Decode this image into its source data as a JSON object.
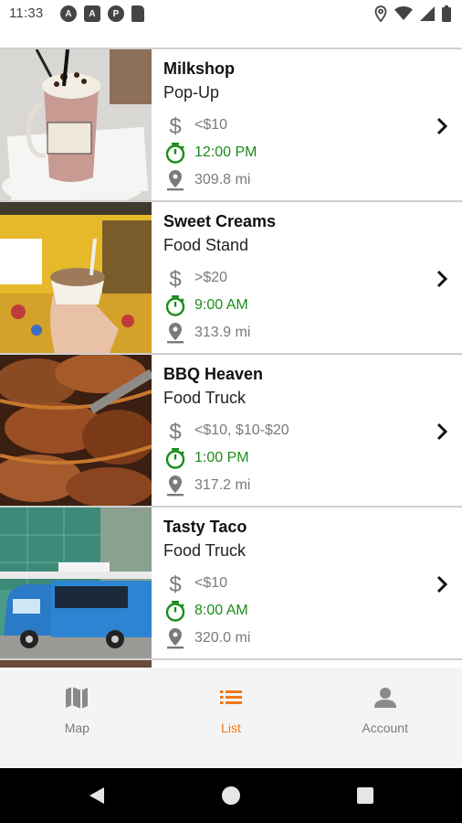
{
  "status_bar": {
    "time": "11:33",
    "notifications": [
      "A",
      "A",
      "P",
      "sd-card-icon"
    ]
  },
  "listings": [
    {
      "name": "Milkshop",
      "category": "Pop-Up",
      "price": "<$10",
      "time": "12:00 PM",
      "distance": "309.8 mi",
      "image": "milkshake-photo"
    },
    {
      "name": "Sweet Creams",
      "category": "Food Stand",
      "price": ">$20",
      "time": "9:00 AM",
      "distance": "313.9 mi",
      "image": "ice-cream-photo"
    },
    {
      "name": "BBQ Heaven",
      "category": "Food Truck",
      "price": "<$10, $10-$20",
      "time": "1:00 PM",
      "distance": "317.2 mi",
      "image": "bbq-photo"
    },
    {
      "name": "Tasty Taco",
      "category": "Food Truck",
      "price": "<$10",
      "time": "8:00 AM",
      "distance": "320.0 mi",
      "image": "food-truck-photo"
    }
  ],
  "bottom_nav": [
    {
      "label": "Map",
      "icon": "map-icon",
      "active": false
    },
    {
      "label": "List",
      "icon": "list-icon",
      "active": true
    },
    {
      "label": "Account",
      "icon": "account-icon",
      "active": false
    }
  ],
  "colors": {
    "accent": "#ef7a1a",
    "time_green": "#1b8c1b",
    "meta_grey": "#7a7a7a"
  }
}
